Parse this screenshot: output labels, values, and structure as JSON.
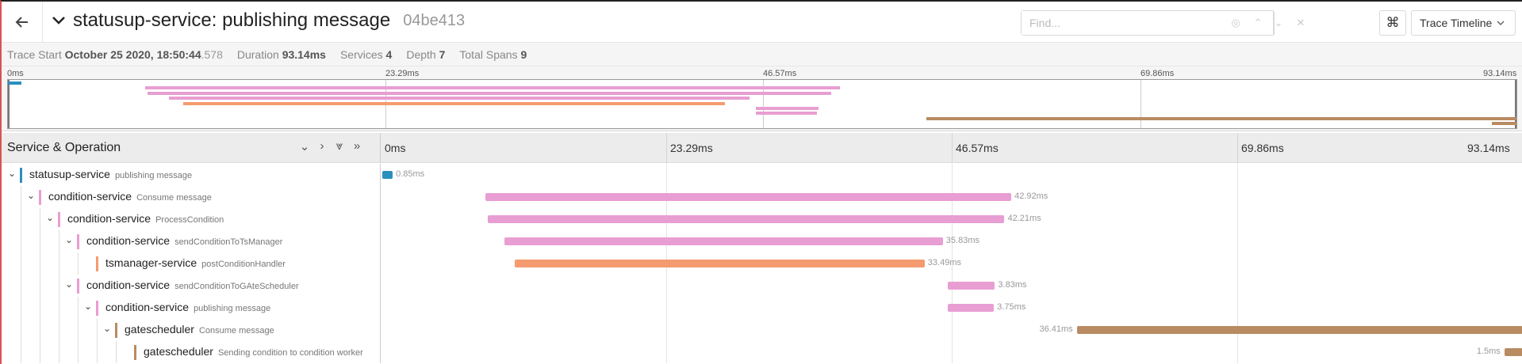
{
  "header": {
    "title": "statusup-service: publishing message",
    "trace_id": "04be413",
    "find_placeholder": "Find...",
    "view_label": "Trace Timeline",
    "kbd_label": "⌘"
  },
  "summary": {
    "trace_start_label": "Trace Start",
    "trace_start_value": "October 25 2020, 18:50:44",
    "trace_start_ms": ".578",
    "duration_label": "Duration",
    "duration_value": "93.14ms",
    "services_label": "Services",
    "services_value": "4",
    "depth_label": "Depth",
    "depth_value": "7",
    "spans_label": "Total Spans",
    "spans_value": "9"
  },
  "minimap_ticks": [
    "0ms",
    "23.29ms",
    "46.57ms",
    "69.86ms",
    "93.14ms"
  ],
  "timeline": {
    "column_title": "Service & Operation",
    "ticks": [
      "0ms",
      "23.29ms",
      "46.57ms",
      "69.86ms",
      "93.14ms"
    ]
  },
  "colors": {
    "statusup": "#2b8fbd",
    "condition": "#e89ed2",
    "tsmanager": "#f49b6f",
    "gatescheduler": "#b98b62"
  },
  "spans": [
    {
      "depth": 0,
      "collapsible": true,
      "service": "statusup-service",
      "operation": "publishing message",
      "color_key": "statusup",
      "start_ms": 0.0,
      "duration_ms": 0.85,
      "label": "0.85ms"
    },
    {
      "depth": 1,
      "collapsible": true,
      "service": "condition-service",
      "operation": "Consume message",
      "color_key": "condition",
      "start_ms": 8.45,
      "duration_ms": 42.92,
      "label": "42.92ms"
    },
    {
      "depth": 2,
      "collapsible": true,
      "service": "condition-service",
      "operation": "ProcessCondition",
      "color_key": "condition",
      "start_ms": 8.6,
      "duration_ms": 42.21,
      "label": "42.21ms"
    },
    {
      "depth": 3,
      "collapsible": true,
      "service": "condition-service",
      "operation": "sendConditionToTsManager",
      "color_key": "condition",
      "start_ms": 9.95,
      "duration_ms": 35.83,
      "label": "35.83ms"
    },
    {
      "depth": 4,
      "collapsible": false,
      "service": "tsmanager-service",
      "operation": "postConditionHandler",
      "color_key": "tsmanager",
      "start_ms": 10.8,
      "duration_ms": 33.49,
      "label": "33.49ms"
    },
    {
      "depth": 3,
      "collapsible": true,
      "service": "condition-service",
      "operation": "sendConditionToGAteScheduler",
      "color_key": "condition",
      "start_ms": 46.2,
      "duration_ms": 3.83,
      "label": "3.83ms"
    },
    {
      "depth": 4,
      "collapsible": true,
      "service": "condition-service",
      "operation": "publishing message",
      "color_key": "condition",
      "start_ms": 46.2,
      "duration_ms": 3.75,
      "label": "3.75ms"
    },
    {
      "depth": 5,
      "collapsible": true,
      "service": "gatescheduler",
      "operation": "Consume message",
      "color_key": "gatescheduler",
      "start_ms": 56.73,
      "duration_ms": 36.41,
      "label": "36.41ms"
    },
    {
      "depth": 6,
      "collapsible": false,
      "service": "gatescheduler",
      "operation": "Sending condition to condition worker",
      "color_key": "gatescheduler",
      "start_ms": 91.64,
      "duration_ms": 1.5,
      "label": "1.5ms"
    }
  ],
  "total_ms": 93.14
}
